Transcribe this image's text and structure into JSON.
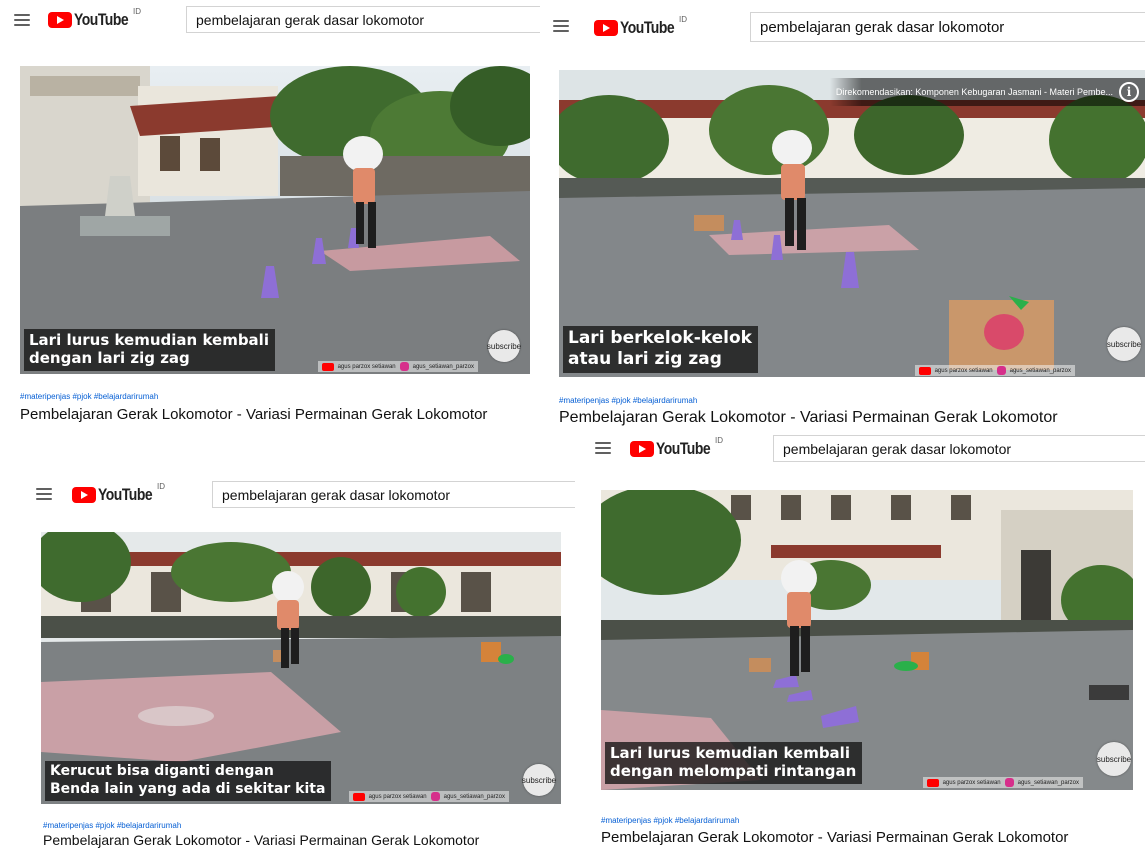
{
  "panels": [
    {
      "search_query": "pembelajaran gerak dasar lokomotor",
      "caption_lines": [
        "Lari lurus kemudian kembali",
        "dengan lari zig zag"
      ],
      "hashtags": "#materipenjas #pjok #belajardarirumah",
      "title": "Pembelajaran Gerak Lokomotor - Variasi Permainan Gerak Lokomotor",
      "subscribe_label": "subscribe",
      "watermark_channel": "agus parzox setiawan",
      "watermark_handle": "agus_setiawan_parzox"
    },
    {
      "search_query": "pembelajaran gerak dasar lokomotor",
      "recommendation": "Direkomendasikan: Komponen Kebugaran Jasmani - Materi Pembe...",
      "caption_lines": [
        "Lari berkelok-kelok",
        "atau lari zig zag"
      ],
      "hashtags": "#materipenjas #pjok #belajardarirumah",
      "title": "Pembelajaran Gerak Lokomotor - Variasi Permainan Gerak Lokomotor",
      "subscribe_label": "subscribe",
      "watermark_channel": "agus parzox setiawan",
      "watermark_handle": "agus_setiawan_parzox"
    },
    {
      "search_query": "pembelajaran gerak dasar lokomotor",
      "caption_lines": [
        "Kerucut bisa diganti dengan",
        "Benda lain yang ada di sekitar kita"
      ],
      "hashtags": "#materipenjas #pjok #belajardarirumah",
      "title": "Pembelajaran Gerak Lokomotor - Variasi Permainan Gerak Lokomotor",
      "subscribe_label": "subscribe",
      "watermark_channel": "agus parzox setiawan",
      "watermark_handle": "agus_setiawan_parzox"
    },
    {
      "search_query": "pembelajaran gerak dasar lokomotor",
      "caption_lines": [
        "Lari lurus kemudian kembali",
        "dengan melompati rintangan"
      ],
      "hashtags": "#materipenjas #pjok #belajardarirumah",
      "title": "Pembelajaran Gerak Lokomotor - Variasi Permainan Gerak Lokomotor",
      "subscribe_label": "subscribe",
      "watermark_channel": "agus parzox setiawan",
      "watermark_handle": "agus_setiawan_parzox"
    }
  ],
  "brand": {
    "logo_text": "YouTube",
    "logo_region": "ID",
    "logo_color": "#ff0000",
    "hashtag_color": "#065fd4"
  },
  "icons": {
    "menu": "hamburger-menu-icon",
    "logo": "youtube-play-icon",
    "info": "info-circle-icon"
  },
  "info_symbol": "i"
}
